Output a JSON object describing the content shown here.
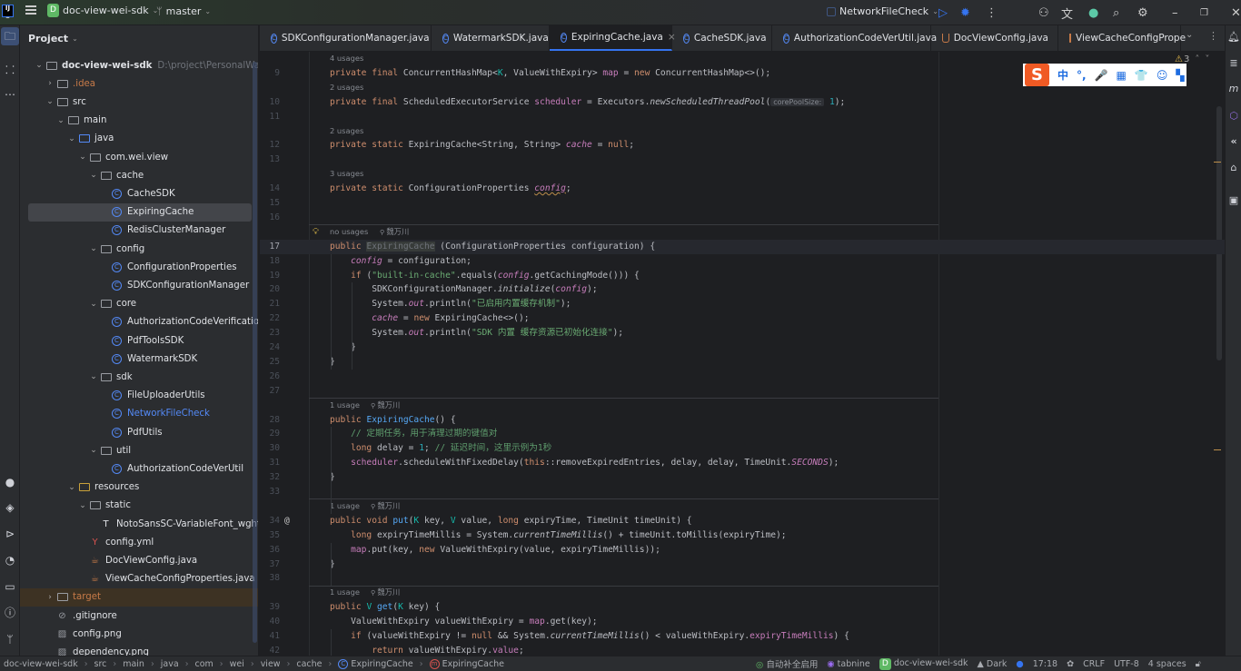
{
  "titlebar": {
    "project_badge": "D",
    "project_name": "doc-view-wei-sdk",
    "branch": "master",
    "run_config": "NetworkFileCheck"
  },
  "project_panel": {
    "title": "Project",
    "tree": [
      {
        "depth": 0,
        "kind": "module",
        "open": true,
        "label": "doc-view-wei-sdk",
        "hint": "D:\\project\\PersonalWarehouse\\",
        "bold": true
      },
      {
        "depth": 1,
        "kind": "folder",
        "open": false,
        "label": ".idea",
        "color": "#c77a48"
      },
      {
        "depth": 1,
        "kind": "folder",
        "open": true,
        "label": "src"
      },
      {
        "depth": 2,
        "kind": "folder",
        "open": true,
        "label": "main"
      },
      {
        "depth": 3,
        "kind": "folder-blue",
        "open": true,
        "label": "java"
      },
      {
        "depth": 4,
        "kind": "package",
        "open": true,
        "label": "com.wei.view"
      },
      {
        "depth": 5,
        "kind": "package",
        "open": true,
        "label": "cache"
      },
      {
        "depth": 6,
        "kind": "class",
        "label": "CacheSDK"
      },
      {
        "depth": 6,
        "kind": "class",
        "label": "ExpiringCache",
        "selected": true
      },
      {
        "depth": 6,
        "kind": "class",
        "label": "RedisClusterManager"
      },
      {
        "depth": 5,
        "kind": "package",
        "open": true,
        "label": "config"
      },
      {
        "depth": 6,
        "kind": "class",
        "label": "ConfigurationProperties"
      },
      {
        "depth": 6,
        "kind": "class",
        "label": "SDKConfigurationManager"
      },
      {
        "depth": 5,
        "kind": "package",
        "open": true,
        "label": "core"
      },
      {
        "depth": 6,
        "kind": "class",
        "label": "AuthorizationCodeVerification"
      },
      {
        "depth": 6,
        "kind": "class",
        "label": "PdfToolsSDK"
      },
      {
        "depth": 6,
        "kind": "class",
        "label": "WatermarkSDK"
      },
      {
        "depth": 5,
        "kind": "package",
        "open": true,
        "label": "sdk"
      },
      {
        "depth": 6,
        "kind": "class",
        "label": "FileUploaderUtils"
      },
      {
        "depth": 6,
        "kind": "class",
        "label": "NetworkFileCheck",
        "color": "#548af7"
      },
      {
        "depth": 6,
        "kind": "class",
        "label": "PdfUtils"
      },
      {
        "depth": 5,
        "kind": "package",
        "open": true,
        "label": "util"
      },
      {
        "depth": 6,
        "kind": "class",
        "label": "AuthorizationCodeVerUtil"
      },
      {
        "depth": 3,
        "kind": "folder-res",
        "open": true,
        "label": "resources"
      },
      {
        "depth": 4,
        "kind": "folder",
        "open": true,
        "label": "static"
      },
      {
        "depth": 5,
        "kind": "font",
        "label": "NotoSansSC-VariableFont_wght.ttf"
      },
      {
        "depth": 4,
        "kind": "yml",
        "label": "config.yml"
      },
      {
        "depth": 4,
        "kind": "java",
        "label": "DocViewConfig.java"
      },
      {
        "depth": 4,
        "kind": "java",
        "label": "ViewCacheConfigProperties.java"
      },
      {
        "depth": 1,
        "kind": "folder-excl",
        "open": false,
        "label": "target",
        "color": "#c77a48",
        "excluded": true
      },
      {
        "depth": 1,
        "kind": "file",
        "label": ".gitignore"
      },
      {
        "depth": 1,
        "kind": "image",
        "label": "config.png"
      },
      {
        "depth": 1,
        "kind": "image",
        "label": "dependency.png"
      }
    ]
  },
  "tabs": [
    {
      "label": "SDKConfigurationManager.java",
      "icon": "class",
      "w": 189
    },
    {
      "label": "WatermarkSDK.java",
      "icon": "class",
      "w": 130
    },
    {
      "label": "ExpiringCache.java",
      "icon": "class",
      "w": 135,
      "active": true,
      "closable": true
    },
    {
      "label": "CacheSDK.java",
      "icon": "class",
      "w": 110
    },
    {
      "label": "AuthorizationCodeVerUtil.java",
      "icon": "class",
      "w": 175
    },
    {
      "label": "DocViewConfig.java",
      "icon": "java",
      "w": 140
    },
    {
      "label": "ViewCacheConfigPrope",
      "icon": "java",
      "w": 135
    }
  ],
  "editor": {
    "warnings_count": "3",
    "rows": [
      {
        "meta": "4 usages"
      },
      {
        "n": "9",
        "t": [
          [
            "kw",
            "private final "
          ],
          [
            "",
            "ConcurrentHashMap<"
          ],
          [
            "tp",
            "K"
          ],
          [
            "",
            ", ValueWithExpiry> "
          ],
          [
            "field",
            "map"
          ],
          [
            "",
            " = "
          ],
          [
            "kw",
            "new "
          ],
          [
            "",
            "ConcurrentHashMap<>();"
          ]
        ]
      },
      {
        "meta": "2 usages"
      },
      {
        "n": "10",
        "t": [
          [
            "kw",
            "private final "
          ],
          [
            "",
            "ScheduledExecutorService "
          ],
          [
            "field",
            "scheduler"
          ],
          [
            "",
            " = Executors."
          ],
          [
            "it",
            "newScheduledThreadPool"
          ],
          [
            "",
            "("
          ],
          [
            "inhint",
            "corePoolSize:"
          ],
          [
            "",
            " "
          ],
          [
            "num",
            "1"
          ],
          [
            "",
            ");"
          ]
        ]
      },
      {
        "n": "11",
        "t": []
      },
      {
        "meta": "2 usages"
      },
      {
        "n": "12",
        "t": [
          [
            "kw",
            "private static "
          ],
          [
            "",
            "ExpiringCache<String, String> "
          ],
          [
            "field it",
            "cache"
          ],
          [
            "",
            " = "
          ],
          [
            "kw",
            "null"
          ],
          [
            "",
            ";"
          ]
        ]
      },
      {
        "n": "13",
        "t": []
      },
      {
        "meta": "3 usages"
      },
      {
        "n": "14",
        "t": [
          [
            "kw",
            "private static "
          ],
          [
            "",
            "ConfigurationProperties "
          ],
          [
            "field it squig",
            "config"
          ],
          [
            "",
            ";"
          ]
        ]
      },
      {
        "n": "15",
        "t": []
      },
      {
        "n": "16",
        "t": [],
        "sepAfter": true
      },
      {
        "meta": "no usages",
        "author": "魏万川",
        "bulb": true
      },
      {
        "n": "17",
        "current": true,
        "t": [
          [
            "kw",
            "public "
          ],
          [
            "hl",
            "ExpiringCache"
          ],
          [
            "",
            " (ConfigurationProperties configuration) {"
          ]
        ]
      },
      {
        "n": "18",
        "t": [
          [
            "",
            "    "
          ],
          [
            "field it",
            "config"
          ],
          [
            "",
            " = configuration;"
          ]
        ]
      },
      {
        "n": "19",
        "t": [
          [
            "",
            "    "
          ],
          [
            "kw",
            "if "
          ],
          [
            "",
            "("
          ],
          [
            "str",
            "\"built-in-cache\""
          ],
          [
            "",
            ".equals("
          ],
          [
            "field it",
            "config"
          ],
          [
            "",
            ".getCachingMode())) {"
          ]
        ]
      },
      {
        "n": "20",
        "t": [
          [
            "",
            "        SDKConfigurationManager."
          ],
          [
            "it",
            "initialize"
          ],
          [
            "",
            "("
          ],
          [
            "field it",
            "config"
          ],
          [
            "",
            ");"
          ]
        ]
      },
      {
        "n": "21",
        "t": [
          [
            "",
            "        System."
          ],
          [
            "field it",
            "out"
          ],
          [
            "",
            ".println("
          ],
          [
            "str",
            "\"已启用内置缓存机制\""
          ],
          [
            "",
            ");"
          ]
        ]
      },
      {
        "n": "22",
        "t": [
          [
            "",
            "        "
          ],
          [
            "field it",
            "cache"
          ],
          [
            "",
            " = "
          ],
          [
            "kw",
            "new "
          ],
          [
            "",
            "ExpiringCache<>();"
          ]
        ]
      },
      {
        "n": "23",
        "t": [
          [
            "",
            "        System."
          ],
          [
            "field it",
            "out"
          ],
          [
            "",
            ".println("
          ],
          [
            "str",
            "\"SDK 内置 缓存资源已初始化连接\""
          ],
          [
            "",
            ");"
          ]
        ]
      },
      {
        "n": "24",
        "t": [
          [
            "",
            "    }"
          ]
        ]
      },
      {
        "n": "25",
        "t": [
          [
            "",
            "}"
          ]
        ]
      },
      {
        "n": "26",
        "t": []
      },
      {
        "n": "27",
        "t": [],
        "sepAfter": true
      },
      {
        "meta": "1 usage",
        "author": "魏万川"
      },
      {
        "n": "28",
        "t": [
          [
            "kw",
            "public "
          ],
          [
            "fn",
            "ExpiringCache"
          ],
          [
            "",
            "() {"
          ]
        ]
      },
      {
        "n": "29",
        "t": [
          [
            "",
            "    "
          ],
          [
            "cmt",
            "// 定期任务，用于清理过期的键值对"
          ]
        ]
      },
      {
        "n": "30",
        "t": [
          [
            "",
            "    "
          ],
          [
            "kw",
            "long "
          ],
          [
            "",
            "delay = "
          ],
          [
            "num",
            "1"
          ],
          [
            "",
            "; "
          ],
          [
            "cmt",
            "// 延迟时间，这里示例为1秒"
          ]
        ]
      },
      {
        "n": "31",
        "t": [
          [
            "",
            "    "
          ],
          [
            "field",
            "scheduler"
          ],
          [
            "",
            ".scheduleWithFixedDelay("
          ],
          [
            "kw",
            "this"
          ],
          [
            "",
            "::removeExpiredEntries, delay, delay, TimeUnit."
          ],
          [
            "field it",
            "SECONDS"
          ],
          [
            "",
            ");"
          ]
        ]
      },
      {
        "n": "32",
        "t": [
          [
            "",
            "}"
          ]
        ]
      },
      {
        "n": "33",
        "t": [],
        "sepAfter": true
      },
      {
        "meta": "1 usage",
        "author": "魏万川"
      },
      {
        "n": "34",
        "at": true,
        "t": [
          [
            "kw",
            "public void "
          ],
          [
            "fn",
            "put"
          ],
          [
            "",
            "("
          ],
          [
            "tp",
            "K"
          ],
          [
            "",
            " key, "
          ],
          [
            "tp",
            "V"
          ],
          [
            "",
            " value, "
          ],
          [
            "kw",
            "long "
          ],
          [
            "",
            "expiryTime, TimeUnit timeUnit) {"
          ]
        ]
      },
      {
        "n": "35",
        "t": [
          [
            "",
            "    "
          ],
          [
            "kw",
            "long "
          ],
          [
            "",
            "expiryTimeMillis = System."
          ],
          [
            "it",
            "currentTimeMillis"
          ],
          [
            "",
            "() + timeUnit.toMillis(expiryTime);"
          ]
        ]
      },
      {
        "n": "36",
        "t": [
          [
            "",
            "    "
          ],
          [
            "field",
            "map"
          ],
          [
            "",
            ".put(key, "
          ],
          [
            "kw",
            "new "
          ],
          [
            "",
            "ValueWithExpiry(value, expiryTimeMillis));"
          ]
        ]
      },
      {
        "n": "37",
        "t": [
          [
            "",
            "}"
          ]
        ]
      },
      {
        "n": "38",
        "t": [],
        "sepAfter": true
      },
      {
        "meta": "1 usage",
        "author": "魏万川"
      },
      {
        "n": "39",
        "t": [
          [
            "kw",
            "public "
          ],
          [
            "tp",
            "V "
          ],
          [
            "fn",
            "get"
          ],
          [
            "",
            "("
          ],
          [
            "tp",
            "K"
          ],
          [
            "",
            " key) {"
          ]
        ]
      },
      {
        "n": "40",
        "t": [
          [
            "",
            "    ValueWithExpiry valueWithExpiry = "
          ],
          [
            "field",
            "map"
          ],
          [
            "",
            ".get(key);"
          ]
        ]
      },
      {
        "n": "41",
        "t": [
          [
            "",
            "    "
          ],
          [
            "kw",
            "if "
          ],
          [
            "",
            "(valueWithExpiry != "
          ],
          [
            "kw",
            "null "
          ],
          [
            "",
            "&& System."
          ],
          [
            "it",
            "currentTimeMillis"
          ],
          [
            "",
            "() < valueWithExpiry."
          ],
          [
            "field",
            "expiryTimeMillis"
          ],
          [
            "",
            ") {"
          ]
        ]
      },
      {
        "n": "42",
        "t": [
          [
            "",
            "        "
          ],
          [
            "kw",
            "return "
          ],
          [
            "",
            "valueWithExpiry."
          ],
          [
            "field",
            "value"
          ],
          [
            "",
            ";"
          ]
        ]
      }
    ]
  },
  "ime_toolbar": {
    "logo": "S",
    "items": [
      "中",
      "°,",
      "🎤",
      "▦",
      "👕",
      "☺",
      "▚"
    ]
  },
  "statusbar": {
    "breadcrumbs": [
      "doc-view-wei-sdk",
      "src",
      "main",
      "java",
      "com",
      "wei",
      "view",
      "cache",
      "ExpiringCache",
      "ExpiringCache"
    ],
    "autocomplete": "自动补全启用",
    "tabnine": "tabnine",
    "project_badge": "D",
    "project": "doc-view-wei-sdk",
    "theme": "Dark",
    "time": "17:18",
    "line_sep": "CRLF",
    "encoding": "UTF-8",
    "indent": "4 spaces"
  }
}
